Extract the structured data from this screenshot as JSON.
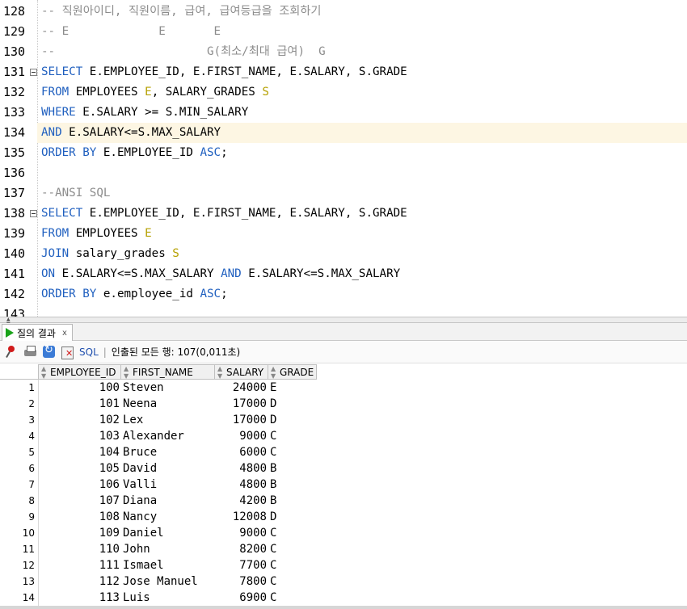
{
  "editor": {
    "lines": [
      {
        "num": "128",
        "parts": [
          {
            "t": "-- 직원아이디, 직원이름, 급여, 급여등급을 조회하기",
            "c": "cm"
          }
        ]
      },
      {
        "num": "129",
        "parts": [
          {
            "t": "-- E             E       E",
            "c": "cm"
          }
        ]
      },
      {
        "num": "130",
        "parts": [
          {
            "t": "--                      G(최소/최대 급여)  G",
            "c": "cm"
          }
        ]
      },
      {
        "num": "131",
        "fold": true,
        "parts": [
          {
            "t": "SELECT",
            "c": "kw"
          },
          {
            "t": " E.EMPLOYEE_ID, E.FIRST_NAME, E.SALARY, S.GRADE",
            "c": ""
          }
        ]
      },
      {
        "num": "132",
        "parts": [
          {
            "t": "FROM",
            "c": "kw"
          },
          {
            "t": " EMPLOYEES ",
            "c": ""
          },
          {
            "t": "E",
            "c": "al"
          },
          {
            "t": ", SALARY_GRADES ",
            "c": ""
          },
          {
            "t": "S",
            "c": "al"
          }
        ]
      },
      {
        "num": "133",
        "parts": [
          {
            "t": "WHERE",
            "c": "kw"
          },
          {
            "t": " E.SALARY >= S.MIN_SALARY",
            "c": ""
          }
        ]
      },
      {
        "num": "134",
        "current": true,
        "parts": [
          {
            "t": "AND",
            "c": "kw"
          },
          {
            "t": " E.SALARY<=S.MAX_SALARY",
            "c": ""
          }
        ]
      },
      {
        "num": "135",
        "parts": [
          {
            "t": "ORDER BY",
            "c": "kw"
          },
          {
            "t": " E.EMPLOYEE_ID ",
            "c": ""
          },
          {
            "t": "ASC",
            "c": "kw"
          },
          {
            "t": ";",
            "c": ""
          }
        ]
      },
      {
        "num": "136",
        "parts": []
      },
      {
        "num": "137",
        "parts": [
          {
            "t": "--ANSI SQL",
            "c": "cm"
          }
        ]
      },
      {
        "num": "138",
        "fold": true,
        "parts": [
          {
            "t": "SELECT",
            "c": "kw"
          },
          {
            "t": " E.EMPLOYEE_ID, E.FIRST_NAME, E.SALARY, S.GRADE",
            "c": ""
          }
        ]
      },
      {
        "num": "139",
        "parts": [
          {
            "t": "FROM",
            "c": "kw"
          },
          {
            "t": " EMPLOYEES ",
            "c": ""
          },
          {
            "t": "E",
            "c": "al"
          }
        ]
      },
      {
        "num": "140",
        "parts": [
          {
            "t": "JOIN",
            "c": "kw"
          },
          {
            "t": " salary_grades ",
            "c": ""
          },
          {
            "t": "S",
            "c": "al"
          }
        ]
      },
      {
        "num": "141",
        "parts": [
          {
            "t": "ON",
            "c": "kw"
          },
          {
            "t": " E.SALARY<=S.MAX_SALARY ",
            "c": ""
          },
          {
            "t": "AND",
            "c": "kw"
          },
          {
            "t": " E.SALARY<=S.MAX_SALARY",
            "c": ""
          }
        ]
      },
      {
        "num": "142",
        "parts": [
          {
            "t": "ORDER BY",
            "c": "kw"
          },
          {
            "t": " e.employee_id ",
            "c": ""
          },
          {
            "t": "ASC",
            "c": "kw"
          },
          {
            "t": ";",
            "c": ""
          }
        ]
      },
      {
        "num": "143",
        "parts": []
      }
    ],
    "colors": {
      "keyword": "#1f5fbf",
      "alias": "#b5a000",
      "comment": "#8c8c8c",
      "current_line": "#fdf6e3"
    }
  },
  "results": {
    "tab_label": "질의 결과",
    "tab_close": "x",
    "toolbar": {
      "icons": [
        "pin-icon",
        "print-icon",
        "refresh-icon",
        "export-icon"
      ],
      "sql_label": "SQL",
      "separator": "|",
      "status": "인출된 모든 행: 107(0,011초)"
    },
    "columns": [
      "EMPLOYEE_ID",
      "FIRST_NAME",
      "SALARY",
      "GRADE"
    ],
    "rows": [
      {
        "n": "1",
        "id": "100",
        "name": "Steven",
        "salary": "24000",
        "grade": "E"
      },
      {
        "n": "2",
        "id": "101",
        "name": "Neena",
        "salary": "17000",
        "grade": "D"
      },
      {
        "n": "3",
        "id": "102",
        "name": "Lex",
        "salary": "17000",
        "grade": "D"
      },
      {
        "n": "4",
        "id": "103",
        "name": "Alexander",
        "salary": "9000",
        "grade": "C"
      },
      {
        "n": "5",
        "id": "104",
        "name": "Bruce",
        "salary": "6000",
        "grade": "C"
      },
      {
        "n": "6",
        "id": "105",
        "name": "David",
        "salary": "4800",
        "grade": "B"
      },
      {
        "n": "7",
        "id": "106",
        "name": "Valli",
        "salary": "4800",
        "grade": "B"
      },
      {
        "n": "8",
        "id": "107",
        "name": "Diana",
        "salary": "4200",
        "grade": "B"
      },
      {
        "n": "9",
        "id": "108",
        "name": "Nancy",
        "salary": "12008",
        "grade": "D"
      },
      {
        "n": "10",
        "id": "109",
        "name": "Daniel",
        "salary": "9000",
        "grade": "C"
      },
      {
        "n": "11",
        "id": "110",
        "name": "John",
        "salary": "8200",
        "grade": "C"
      },
      {
        "n": "12",
        "id": "111",
        "name": "Ismael",
        "salary": "7700",
        "grade": "C"
      },
      {
        "n": "13",
        "id": "112",
        "name": "Jose Manuel",
        "salary": "7800",
        "grade": "C"
      },
      {
        "n": "14",
        "id": "113",
        "name": "Luis",
        "salary": "6900",
        "grade": "C"
      }
    ]
  }
}
